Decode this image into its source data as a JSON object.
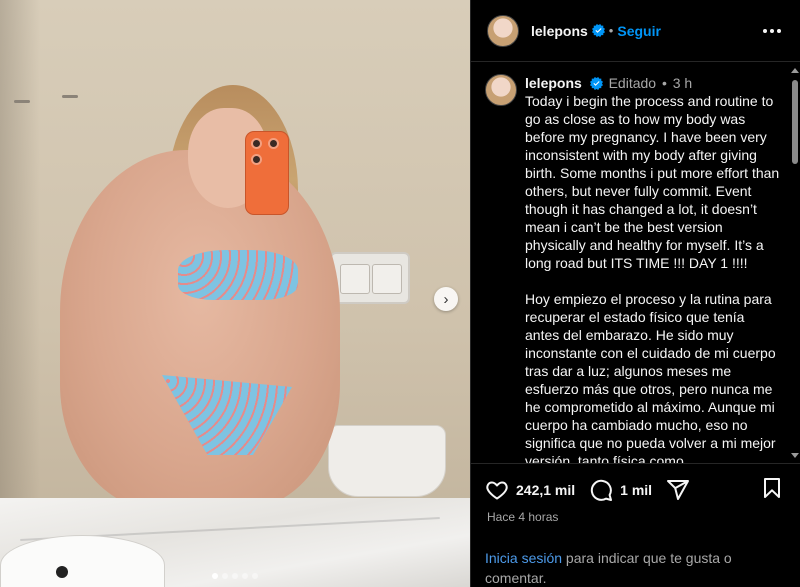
{
  "post": {
    "carousel": {
      "slide_count": 5,
      "active_index": 0
    },
    "next_icon": "chevron-right-icon"
  },
  "header": {
    "username": "lelepons",
    "verified_icon": "verified-badge-icon",
    "separator": "•",
    "follow_label": "Seguir",
    "more_icon": "more-horizontal-icon"
  },
  "caption": {
    "username": "lelepons",
    "edited_label": "Editado",
    "separator": "•",
    "time": "3 h",
    "text": "Today i begin the process and routine to go as close as to how my body was before my pregnancy. I have been very inconsistent with my body after giving birth. Some months i put more effort than others, but never fully commit. Event though it has changed a lot, it doesn’t mean i can’t be the best version physically and healthy for myself. It’s a long road but ITS TIME !!! DAY 1 !!!!\n\nHoy empiezo el proceso y la rutina para recuperar el estado físico que tenía antes del embarazo. He sido muy inconstante con el cuidado de mi cuerpo tras dar a luz; algunos meses me esfuerzo más que otros, pero nunca me he comprometido al máximo. Aunque mi cuerpo ha cambiado mucho, eso no significa que no pueda volver a mi mejor versión, tanto física como"
  },
  "actions": {
    "like_icon": "heart-icon",
    "like_count": "242,1 mil",
    "comment_icon": "comment-icon",
    "comment_count": "1 mil",
    "share_icon": "share-icon",
    "save_icon": "bookmark-icon"
  },
  "timestamp": "Hace 4 horas",
  "login_prompt": {
    "link_label": "Inicia sesión",
    "rest": " para indicar que te gusta o comentar."
  },
  "colors": {
    "background": "#000000",
    "accent_blue": "#0095f6",
    "link_blue": "#4d9bea",
    "muted_text": "#a8a8a8"
  }
}
